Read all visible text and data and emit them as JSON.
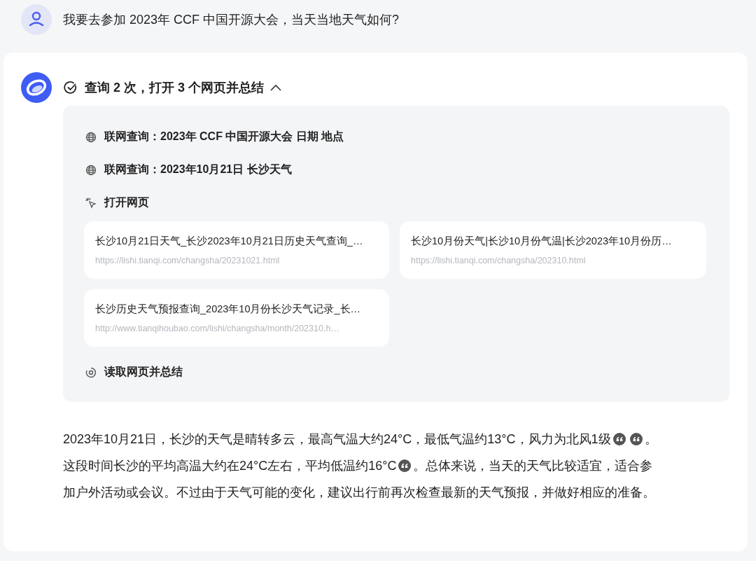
{
  "user_message": {
    "text": "我要去参加 2023年 CCF 中国开源大会，当天当地天气如何?"
  },
  "assistant": {
    "summary": {
      "text": "查询 2 次，打开 3 个网页并总结",
      "done": true,
      "expanded": true
    },
    "steps": [
      {
        "kind": "search",
        "text": "联网查询：2023年 CCF 中国开源大会 日期 地点"
      },
      {
        "kind": "search",
        "text": "联网查询：2023年10月21日 长沙天气"
      },
      {
        "kind": "open",
        "text": "打开网页",
        "pages": [
          {
            "title": "长沙10月21日天气_长沙2023年10月21日历史天气查询_…",
            "url": "https://lishi.tianqi.com/changsha/20231021.html"
          },
          {
            "title": "长沙10月份天气|长沙10月份气温|长沙2023年10月份历…",
            "url": "https://lishi.tianqi.com/changsha/202310.html"
          },
          {
            "title": "长沙历史天气预报查询_2023年10月份长沙天气记录_长…",
            "url": "http://www.tianqihoubao.com/lishi/changsha/month/202310.h…"
          }
        ]
      },
      {
        "kind": "read",
        "text": "读取网页并总结"
      }
    ],
    "answer": [
      [
        {
          "kind": "text",
          "text": "2023年10月21日，长沙的天气是晴转多云，最高气温大约24°C，最低气温约13°C，风力为北风1级"
        },
        {
          "kind": "cite"
        },
        {
          "kind": "cite"
        },
        {
          "kind": "text",
          "text": "。"
        }
      ],
      [
        {
          "kind": "text",
          "text": "这段时间长沙的平均高温大约在24°C左右，平均低温约16°C"
        },
        {
          "kind": "cite"
        },
        {
          "kind": "text",
          "text": "。总体来说，当天的天气比较适宜，适合参"
        }
      ],
      [
        {
          "kind": "text",
          "text": "加户外活动或会议。不过由于天气可能的变化，建议出行前再次检查最新的天气预报，并做好相应的准备。"
        }
      ]
    ]
  }
}
